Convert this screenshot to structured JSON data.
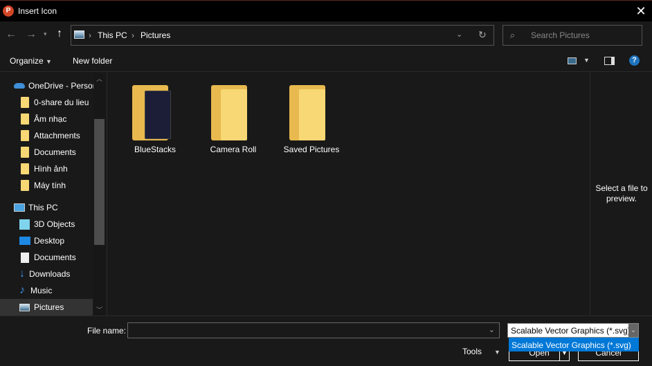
{
  "title": "Insert Icon",
  "address": {
    "segments": [
      "This PC",
      "Pictures"
    ]
  },
  "search": {
    "placeholder": "Search Pictures"
  },
  "toolbar": {
    "organize": "Organize",
    "new_folder": "New folder"
  },
  "sidebar": {
    "items": [
      {
        "label": "OneDrive - Personal",
        "icon": "onedrive-icon"
      },
      {
        "label": "0-share du lieu",
        "icon": "folder-icon"
      },
      {
        "label": "Âm nhạc",
        "icon": "folder-icon"
      },
      {
        "label": "Attachments",
        "icon": "folder-icon"
      },
      {
        "label": "Documents",
        "icon": "folder-icon"
      },
      {
        "label": "Hình ảnh",
        "icon": "folder-icon"
      },
      {
        "label": "Máy tính",
        "icon": "folder-icon"
      },
      {
        "label": "This PC",
        "icon": "computer-icon"
      },
      {
        "label": "3D Objects",
        "icon": "cube-icon"
      },
      {
        "label": "Desktop",
        "icon": "desktop-icon"
      },
      {
        "label": "Documents",
        "icon": "document-icon"
      },
      {
        "label": "Downloads",
        "icon": "download-icon"
      },
      {
        "label": "Music",
        "icon": "music-icon"
      },
      {
        "label": "Pictures",
        "icon": "pictures-icon"
      }
    ]
  },
  "files": [
    {
      "name": "BlueStacks"
    },
    {
      "name": "Camera Roll"
    },
    {
      "name": "Saved Pictures"
    }
  ],
  "preview": {
    "text": "Select a file to preview."
  },
  "footer": {
    "file_name_label": "File name:",
    "file_name_value": "",
    "file_type": "Scalable Vector Graphics (*.svg)",
    "dropdown_options": [
      "Scalable Vector Graphics (*.svg)"
    ],
    "tools": "Tools",
    "open": "Open",
    "cancel": "Cancel"
  }
}
